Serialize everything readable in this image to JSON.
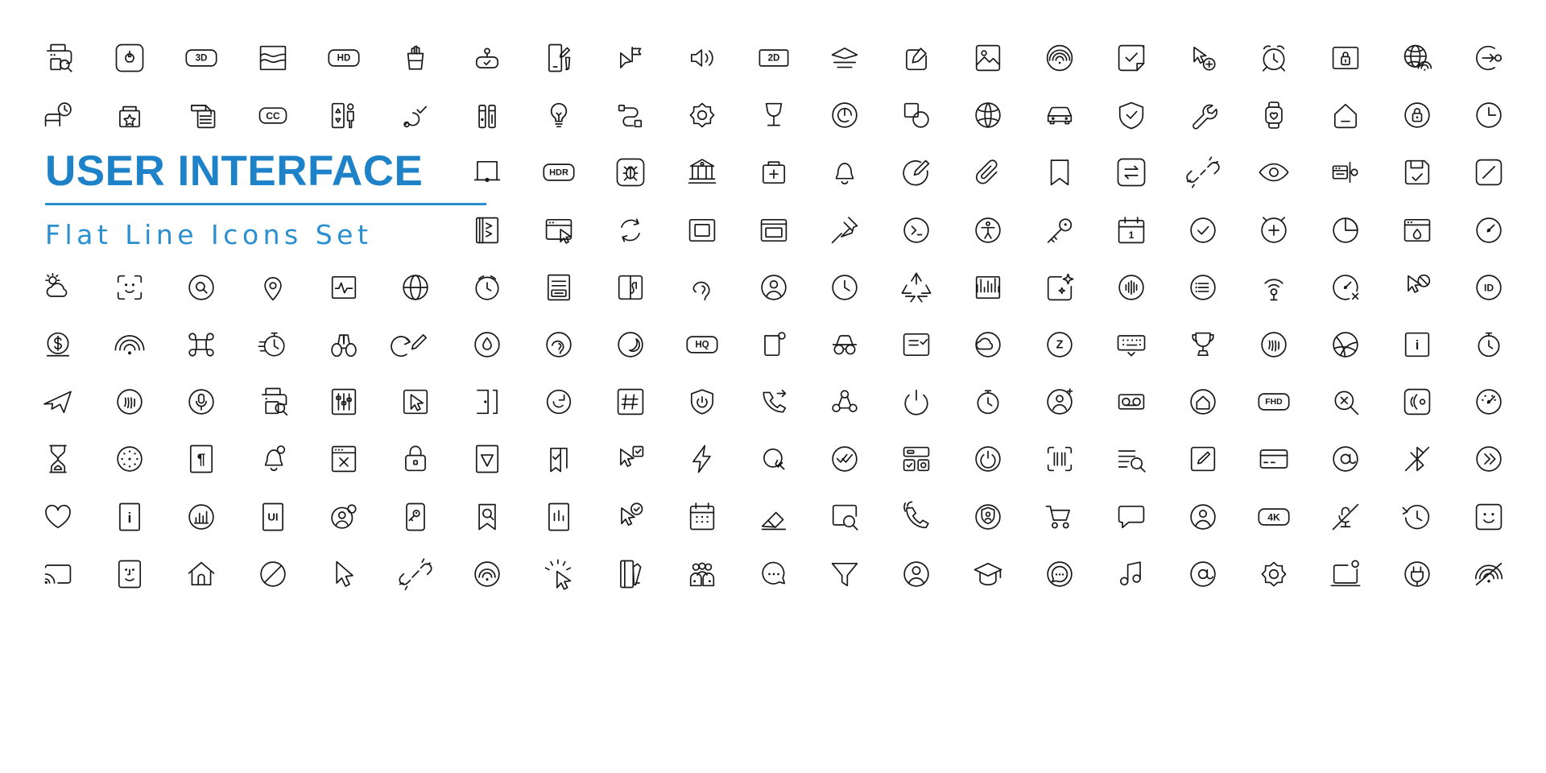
{
  "poster": {
    "title": "USER INTERFACE",
    "subtitle": "Flat Line Icons Set",
    "accent_color": "#1e82c8",
    "rule_color": "#2a8fd0",
    "icon_color": "#19191b",
    "background_color": "#ffffff",
    "columns": 21,
    "rows": 10,
    "total_icons": 198
  },
  "badge_labels": {
    "threed": "3D",
    "hd": "HD",
    "twod": "2D",
    "cc": "CC",
    "hdr": "HDR",
    "hq": "HQ",
    "fhd": "FHD",
    "fourk": "4K",
    "ui": "UI",
    "id": "ID",
    "info": "i",
    "pilcrow": "¶",
    "hash": "#",
    "at": "@",
    "z": "Z"
  },
  "grid": [
    {
      "row": 1,
      "icons": [
        "printer-search-icon",
        "lightbulb-square-icon",
        "3d-badge-icon",
        "image-wave-icon",
        "hd-badge-icon",
        "fries-icon",
        "perfume-check-icon",
        "note-pen-icon",
        "cursor-flag-icon",
        "volume-up-icon",
        "2d-badge-icon",
        "layers-align-icon",
        "edit-square-icon",
        "image-picture-icon",
        "wifi-circle-icon",
        "check-square-icon",
        "cursor-add-icon",
        "alarm-clock-icon",
        "lock-square-icon",
        "globe-wifi-icon",
        "login-circle-icon"
      ]
    },
    {
      "row": 2,
      "icons": [
        "bed-clock-icon",
        "box-star-icon",
        "print-list-icon",
        "cc-badge-icon",
        "elevator-icon",
        "pointer-check-icon",
        "battery-test-icon",
        "idea-bulb-icon",
        "route-node-icon",
        "settings-gear-icon",
        "wine-glass-icon",
        "target-swirl-icon",
        "shapes-overlap-icon",
        "globe-sphere-icon",
        "car-front-icon",
        "shield-check-icon",
        "wrench-icon",
        "smartwatch-heart-icon",
        "home-minus-icon",
        "lock-rounded-icon",
        "clock-quarter-icon"
      ]
    },
    {
      "row": 3,
      "title_span": [
        1,
        6
      ],
      "icons": [
        "whiteboard-icon",
        "hdr-badge-icon",
        "bug-square-icon",
        "bank-icon",
        "first-aid-kit-icon",
        "bell-icon",
        "edit-circle-icon",
        "paperclip-icon",
        "bookmark-icon",
        "transfer-square-icon",
        "broken-link-icon",
        "eye-icon",
        "toolbox-panel-icon",
        "save-check-icon",
        "square-rounded-icon"
      ]
    },
    {
      "row": 4,
      "title_span": [
        1,
        6
      ],
      "icons": [
        "book-open-icon",
        "browser-cursor-icon",
        "refresh-sync-icon",
        "frame-square-icon",
        "window-panel-icon",
        "pushpin-icon",
        "terminal-circle-icon",
        "accessibility-circle-icon",
        "key-icon",
        "calendar-day-icon",
        "check-circle-icon",
        "add-clock-icon",
        "pie-chart-icon",
        "browser-tint-icon",
        "speedometer-icon"
      ]
    },
    {
      "row": 5,
      "icons": [
        "weather-sun-cloud-icon",
        "face-scan-icon",
        "search-oval-icon",
        "map-pin-icon",
        "pulse-chart-icon",
        "globe-grid-icon",
        "timer-clock-icon",
        "document-lines-icon",
        "image-crop-icon",
        "ear-listen-icon",
        "user-circle-icon",
        "clock-icon",
        "recycle-icon",
        "equalizer-bars-icon",
        "sparkle-square-icon",
        "soundwave-circle-icon",
        "list-circle-icon",
        "signal-tower-icon",
        "dashboard-error-icon",
        "cursor-block-icon",
        "id-badge-circle-icon"
      ]
    },
    {
      "row": 6,
      "icons": [
        "dollar-circle-icon",
        "wifi-signal-icon",
        "command-key-icon",
        "stopwatch-fast-icon",
        "binoculars-icon",
        "undo-edit-icon",
        "water-drop-circle-icon",
        "ear-circle-icon",
        "moon-circle-icon",
        "hq-badge-icon",
        "copy-corner-icon",
        "incognito-icon",
        "checklist-square-icon",
        "cloud-circle-icon",
        "z-circle-icon",
        "keyboard-hide-icon",
        "trophy-icon",
        "fingerprint-circle-icon",
        "dribbble-circle-icon",
        "info-square-icon",
        "timer-circle-icon"
      ]
    },
    {
      "row": 7,
      "icons": [
        "airplane-icon",
        "fingerprint-scan-icon",
        "microphone-circle-icon",
        "printer-zoom-icon",
        "equalizer-sliders-icon",
        "cursor-arrow-square-icon",
        "door-exit-icon",
        "refresh-circle-icon",
        "hashtag-square-icon",
        "shield-power-icon",
        "call-forward-icon",
        "share-nodes-icon",
        "power-button-icon",
        "timer-snooze-icon",
        "user-share-icon",
        "voicemail-icon",
        "home-circle-icon",
        "fhd-badge-icon",
        "search-close-icon",
        "nfc-scan-icon",
        "gauge-meter-icon"
      ]
    },
    {
      "row": 8,
      "icons": [
        "hourglass-icon",
        "clock-dots-icon",
        "pilcrow-square-icon",
        "bell-ring-icon",
        "browser-close-icon",
        "padlock-icon",
        "send-square-icon",
        "bookmark-check-icon",
        "cursor-check-icon",
        "lightning-bolt-icon",
        "search-check-icon",
        "double-check-circle-icon",
        "layout-blocks-icon",
        "power-circle-icon",
        "barcode-scan-icon",
        "list-search-icon",
        "edit-pencil-square-icon",
        "credit-card-icon",
        "at-circle-icon",
        "bluetooth-off-icon",
        "chevron-double-right-icon"
      ]
    },
    {
      "row": 9,
      "icons": [
        "heart-icon",
        "info-rect-icon",
        "chart-circle-icon",
        "ui-badge-icon",
        "user-add-circle-icon",
        "mobile-key-icon",
        "bookmark-search-icon",
        "bar-chart-square-icon",
        "cursor-check-circle-icon",
        "calendar-grid-icon",
        "eraser-icon",
        "image-search-icon",
        "phone-call-icon",
        "shield-person-icon",
        "shopping-cart-icon",
        "chat-bubble-icon",
        "user-profile-circle-icon",
        "4k-badge-icon",
        "mic-off-slash-icon",
        "history-clock-icon",
        "smiley-square-icon"
      ]
    },
    {
      "row": 10,
      "icons": [
        "cast-screen-icon",
        "face-id-square-icon",
        "home-house-icon",
        "block-circle-icon",
        "cursor-pointer-icon",
        "broken-chain-icon",
        "wifi-circle-signal-icon",
        "click-tap-icon",
        "notebook-pen-icon",
        "team-group-icon",
        "chat-search-icon",
        "filter-funnel-icon",
        "user-avatar-icon",
        "graduation-cap-icon",
        "chat-dots-icon",
        "music-note-icon",
        "at-sign-circle-icon",
        "settings-cog-icon",
        "laptop-corner-icon",
        "plug-power-icon",
        "wifi-off-icon"
      ]
    }
  ]
}
